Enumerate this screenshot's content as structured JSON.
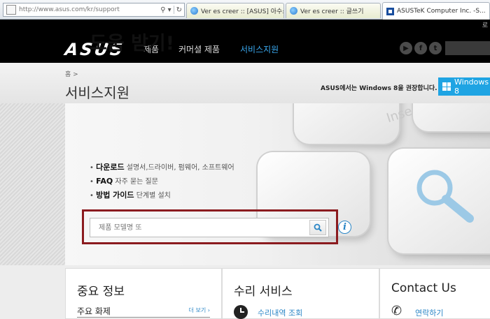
{
  "browser": {
    "url": "http://www.asus.com/kr/support",
    "tabs": [
      {
        "label": "Ver es creer :: [ASUS] 아수스 ...",
        "active": false
      },
      {
        "label": "Ver es creer :: 글쓰기",
        "active": false
      },
      {
        "label": "ASUSTeK Computer Inc. -S...",
        "active": true
      }
    ],
    "strip_text": "로"
  },
  "header": {
    "logo": "ASUS",
    "nav": [
      "제품",
      "커머셜 제품",
      "서비스지원"
    ],
    "active_nav": "서비스지원",
    "social": [
      "youtube-icon",
      "facebook-icon",
      "twitter-icon"
    ]
  },
  "title_band": {
    "breadcrumb": "홈 >",
    "title": "서비스지원",
    "windows_note": "ASUS에서는 Windows 8을 권장합니다.",
    "windows_badge": "Windows 8"
  },
  "hero": {
    "heading": "도움 받기!",
    "bullets": [
      {
        "strong": "다운로드",
        "rest": "설명서,드라이버, 펌웨어, 소프트웨어"
      },
      {
        "strong": "FAQ",
        "rest": "자주 묻는 질문"
      },
      {
        "strong": "방법 가이드",
        "rest": "단계별 설치"
      }
    ],
    "search_placeholder": "제품 모델명 또",
    "key_text": "Inse"
  },
  "panels": [
    {
      "title": "중요 정보",
      "sub": "주요 화제",
      "more": "더 보기 ›"
    },
    {
      "title": "수리 서비스",
      "link": "수리내역 조회"
    },
    {
      "title": "Contact Us",
      "link": "연락하기"
    }
  ],
  "colors": {
    "accent_blue": "#2a86c6",
    "nav_active": "#3aa9f0",
    "search_frame": "#8b1b1f",
    "windows_blue": "#1fa4e3"
  }
}
